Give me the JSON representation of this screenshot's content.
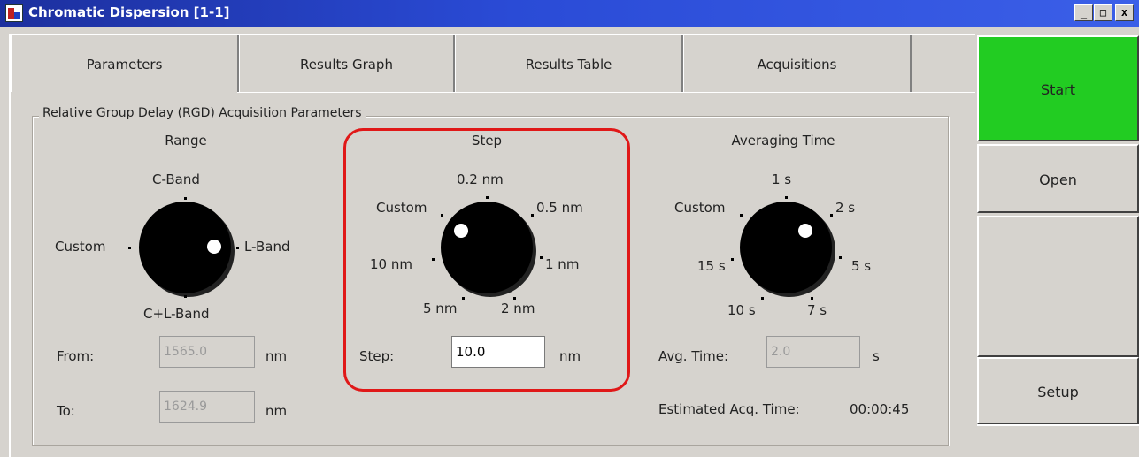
{
  "window": {
    "title": "Chromatic Dispersion [1-1]",
    "controls": {
      "minimize": "_",
      "maximize": "□",
      "close": "x"
    }
  },
  "tabs": [
    {
      "label": "Parameters",
      "active": true
    },
    {
      "label": "Results Graph",
      "active": false
    },
    {
      "label": "Results Table",
      "active": false
    },
    {
      "label": "Acquisitions",
      "active": false
    }
  ],
  "group": {
    "title": "Relative Group Delay (RGD) Acquisition Parameters"
  },
  "range": {
    "title": "Range",
    "positions": {
      "top": "C-Band",
      "right": "L-Band",
      "bottom": "C+L-Band",
      "left": "Custom"
    },
    "selected": "L-Band",
    "from_label": "From:",
    "from_value": "1565.0",
    "from_unit": "nm",
    "to_label": "To:",
    "to_value": "1624.9",
    "to_unit": "nm"
  },
  "step": {
    "title": "Step",
    "positions": {
      "p1": "0.2 nm",
      "p2": "0.5 nm",
      "p3": "1 nm",
      "p4": "2 nm",
      "p5": "5 nm",
      "p6": "10 nm",
      "p7": "Custom"
    },
    "selected": "Custom",
    "field_label": "Step:",
    "field_value": "10.0",
    "field_unit": "nm"
  },
  "averaging": {
    "title": "Averaging Time",
    "positions": {
      "p1": "1 s",
      "p2": "2 s",
      "p3": "5 s",
      "p4": "7 s",
      "p5": "10 s",
      "p6": "15 s",
      "p7": "Custom"
    },
    "selected": "2 s",
    "field_label": "Avg. Time:",
    "field_value": "2.0",
    "field_unit": "s",
    "estimate_label": "Estimated Acq. Time:",
    "estimate_value": "00:00:45"
  },
  "side_buttons": {
    "start": "Start",
    "open": "Open",
    "setup": "Setup"
  },
  "colors": {
    "titlebar": "#2a4bd6",
    "start": "#22cc22",
    "highlight": "#e01818",
    "face": "#d6d3ce"
  },
  "icons": {
    "app": "app-icon",
    "knob": "rotary-knob-icon"
  }
}
